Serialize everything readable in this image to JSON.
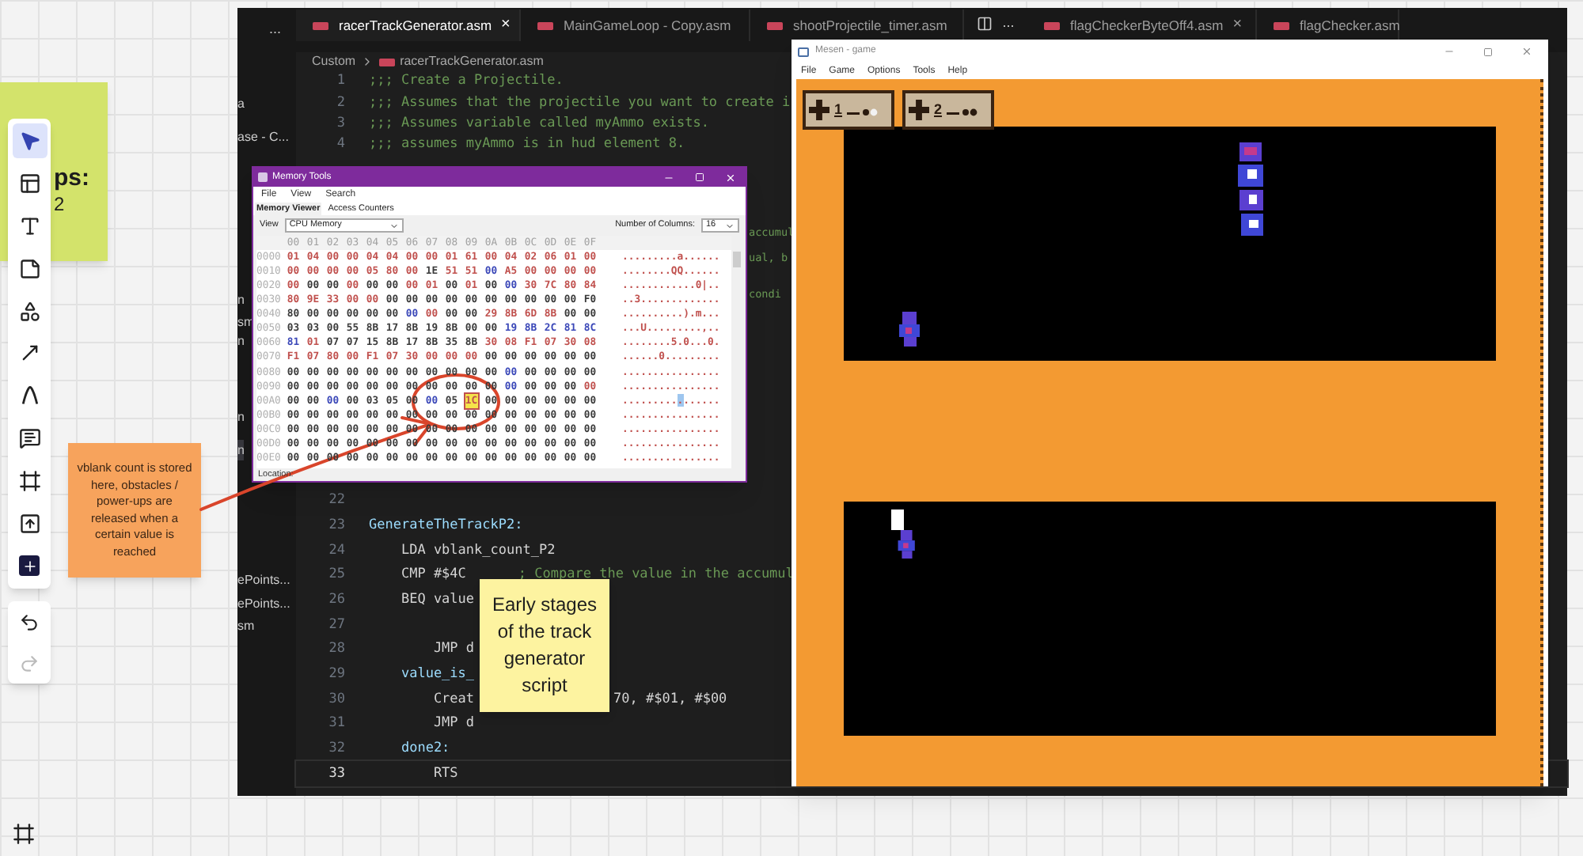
{
  "green_note": {
    "texts": [
      "ps:",
      "2"
    ]
  },
  "toolbar": {
    "tools": [
      {
        "kind": "select",
        "selected": true
      },
      {
        "kind": "templates",
        "selected": false
      },
      {
        "kind": "text",
        "selected": false
      },
      {
        "kind": "sticky",
        "selected": false
      },
      {
        "kind": "shapes",
        "selected": false
      },
      {
        "kind": "arrow",
        "selected": false
      },
      {
        "kind": "pen",
        "selected": false
      },
      {
        "kind": "comment",
        "selected": false
      },
      {
        "kind": "frame",
        "selected": false
      },
      {
        "kind": "upload",
        "selected": false
      },
      {
        "kind": "more",
        "selected": false
      }
    ]
  },
  "history": {
    "undo": {
      "disabled": false
    },
    "redo": {
      "disabled": true
    }
  },
  "orange_note": {
    "text": "vblank count is stored here, obstacles / power-ups are released when a certain value is reached"
  },
  "editor": {
    "sidebar_menu": "...",
    "sidebar_items": [
      {
        "label": "a",
        "selected": false
      },
      {
        "label": "ase - C...",
        "selected": false
      },
      {
        "label": "n",
        "selected": false
      },
      {
        "label": "sm",
        "selected": false
      },
      {
        "label": "n",
        "selected": false
      },
      {
        "label": "n",
        "selected": false
      },
      {
        "label": "n",
        "selected": true
      },
      {
        "label": "ePoints...",
        "selected": false
      },
      {
        "label": "ePoints...",
        "selected": false
      },
      {
        "label": "sm",
        "selected": false
      }
    ],
    "tabs": [
      {
        "label": "racerTrackGenerator.asm",
        "selected": true,
        "close": "×"
      },
      {
        "label": "MainGameLoop - Copy.asm",
        "selected": false
      },
      {
        "label": "shootProjectile_timer.asm",
        "selected": false
      },
      {
        "label": "flagCheckerByteOff4.asm",
        "selected": false,
        "close": "×"
      },
      {
        "label": "flagChecker.asm",
        "selected": false
      }
    ],
    "tab_actions_more": "...",
    "breadcrumb": [
      "Custom",
      "racerTrackGenerator.asm"
    ],
    "top_lines": [
      {
        "number": "1",
        "kind": "comment",
        "text": ";;; Create a Projectile."
      },
      {
        "number": "2",
        "kind": "comment",
        "text": ";;; Assumes that the projectile you want to create i"
      },
      {
        "number": "3",
        "kind": "comment",
        "text": ";;; Assumes variable called myAmmo exists."
      },
      {
        "number": "4",
        "kind": "comment",
        "text": ";;; assumes myAmmo is in hud element 8."
      }
    ],
    "fragments": [
      {
        "kind": "comment",
        "text": "accumul"
      },
      {
        "kind": "comment",
        "text": "ual, b"
      },
      {
        "kind": "comment",
        "text": "condi"
      }
    ],
    "bottom_lines": [
      {
        "number": "22",
        "current": false
      },
      {
        "number": "23",
        "kind": "label",
        "text": "GenerateTheTrackP2:",
        "current": false
      },
      {
        "number": "24",
        "kind": "code",
        "text": "    LDA vblank_count_P2",
        "current": false
      },
      {
        "number": "25",
        "kind": "code",
        "text": "    CMP #$4C",
        "comment": "; Compare the value in the accumul",
        "current": false
      },
      {
        "number": "26",
        "kind": "code",
        "text": "    BEQ value",
        "current": false
      },
      {
        "number": "27",
        "current": false
      },
      {
        "number": "28",
        "kind": "code",
        "text": "        JMP d",
        "current": false
      },
      {
        "number": "29",
        "kind": "label",
        "text": "    value_is_",
        "current": false
      },
      {
        "number": "30",
        "kind": "code",
        "text": "        Creat",
        "tail": "70, #$01, #$00",
        "current": false
      },
      {
        "number": "31",
        "kind": "code",
        "text": "        JMP d",
        "current": false
      },
      {
        "number": "32",
        "kind": "label",
        "text": "    done2:",
        "current": false
      },
      {
        "number": "33",
        "kind": "code",
        "text": "        RTS",
        "current": true
      }
    ]
  },
  "memory_tools": {
    "title": "Memory Tools",
    "menu": [
      "File",
      "View",
      "Search"
    ],
    "tabs": [
      {
        "label": "Memory Viewer",
        "selected": true
      },
      {
        "label": "Access Counters",
        "selected": false
      }
    ],
    "view_label": "View",
    "view_value": "CPU Memory",
    "columns_label": "Number of Columns:",
    "columns_value": "16",
    "header": [
      "00",
      "01",
      "02",
      "03",
      "04",
      "05",
      "06",
      "07",
      "08",
      "09",
      "0A",
      "0B",
      "0C",
      "0D",
      "0E",
      "0F"
    ],
    "rows": [
      {
        "address": "0000",
        "ascii": ".........a......",
        "cells": [
          {
            "value": "01",
            "color": "#c0504d",
            "selected": false
          },
          {
            "value": "04",
            "color": "#c0504d",
            "selected": false
          },
          {
            "value": "00",
            "color": "#c0504d",
            "selected": false
          },
          {
            "value": "00",
            "color": "#c0504d",
            "selected": false
          },
          {
            "value": "04",
            "color": "#c0504d",
            "selected": false
          },
          {
            "value": "04",
            "color": "#c0504d",
            "selected": false
          },
          {
            "value": "00",
            "color": "#c0504d",
            "selected": false
          },
          {
            "value": "00",
            "color": "#c0504d",
            "selected": false
          },
          {
            "value": "01",
            "color": "#c0504d",
            "selected": false
          },
          {
            "value": "61",
            "color": "#c0504d",
            "selected": false
          },
          {
            "value": "00",
            "color": "#c0504d",
            "selected": false
          },
          {
            "value": "04",
            "color": "#c0504d",
            "selected": false
          },
          {
            "value": "02",
            "color": "#c0504d",
            "selected": false
          },
          {
            "value": "06",
            "color": "#c0504d",
            "selected": false
          },
          {
            "value": "01",
            "color": "#c0504d",
            "selected": false
          },
          {
            "value": "00",
            "color": "#c0504d",
            "selected": false
          }
        ]
      },
      {
        "address": "0010",
        "ascii": "........QQ......",
        "cells": [
          {
            "value": "00",
            "color": "#c0504d",
            "selected": false
          },
          {
            "value": "00",
            "color": "#c0504d",
            "selected": false
          },
          {
            "value": "00",
            "color": "#c0504d",
            "selected": false
          },
          {
            "value": "00",
            "color": "#c0504d",
            "selected": false
          },
          {
            "value": "05",
            "color": "#c0504d",
            "selected": false
          },
          {
            "value": "80",
            "color": "#c0504d",
            "selected": false
          },
          {
            "value": "00",
            "color": "#c0504d",
            "selected": false
          },
          {
            "value": "1E",
            "color": "#3a3a3a",
            "selected": false
          },
          {
            "value": "51",
            "color": "#c0504d",
            "selected": false
          },
          {
            "value": "51",
            "color": "#c0504d",
            "selected": false
          },
          {
            "value": "00",
            "color": "#3a47b8",
            "selected": false
          },
          {
            "value": "A5",
            "color": "#c0504d",
            "selected": false
          },
          {
            "value": "00",
            "color": "#c0504d",
            "selected": false
          },
          {
            "value": "00",
            "color": "#c0504d",
            "selected": false
          },
          {
            "value": "00",
            "color": "#c0504d",
            "selected": false
          },
          {
            "value": "00",
            "color": "#c0504d",
            "selected": false
          }
        ]
      },
      {
        "address": "0020",
        "ascii": "............0|..",
        "cells": [
          {
            "value": "00",
            "color": "#c0504d",
            "selected": false
          },
          {
            "value": "00",
            "color": "#3a3a3a",
            "selected": false
          },
          {
            "value": "00",
            "color": "#3a3a3a",
            "selected": false
          },
          {
            "value": "00",
            "color": "#c0504d",
            "selected": false
          },
          {
            "value": "00",
            "color": "#3a3a3a",
            "selected": false
          },
          {
            "value": "00",
            "color": "#3a3a3a",
            "selected": false
          },
          {
            "value": "00",
            "color": "#c0504d",
            "selected": false
          },
          {
            "value": "01",
            "color": "#c0504d",
            "selected": false
          },
          {
            "value": "00",
            "color": "#3a3a3a",
            "selected": false
          },
          {
            "value": "01",
            "color": "#c0504d",
            "selected": false
          },
          {
            "value": "00",
            "color": "#3a3a3a",
            "selected": false
          },
          {
            "value": "00",
            "color": "#3a47b8",
            "selected": false
          },
          {
            "value": "30",
            "color": "#c0504d",
            "selected": false
          },
          {
            "value": "7C",
            "color": "#c0504d",
            "selected": false
          },
          {
            "value": "80",
            "color": "#c0504d",
            "selected": false
          },
          {
            "value": "84",
            "color": "#c0504d",
            "selected": false
          }
        ]
      },
      {
        "address": "0030",
        "ascii": "..3.............",
        "cells": [
          {
            "value": "80",
            "color": "#c0504d",
            "selected": false
          },
          {
            "value": "9E",
            "color": "#c0504d",
            "selected": false
          },
          {
            "value": "33",
            "color": "#c0504d",
            "selected": false
          },
          {
            "value": "00",
            "color": "#c0504d",
            "selected": false
          },
          {
            "value": "00",
            "color": "#c0504d",
            "selected": false
          },
          {
            "value": "00",
            "color": "#3a3a3a",
            "selected": false
          },
          {
            "value": "00",
            "color": "#3a3a3a",
            "selected": false
          },
          {
            "value": "00",
            "color": "#3a3a3a",
            "selected": false
          },
          {
            "value": "00",
            "color": "#3a3a3a",
            "selected": false
          },
          {
            "value": "00",
            "color": "#3a3a3a",
            "selected": false
          },
          {
            "value": "00",
            "color": "#3a3a3a",
            "selected": false
          },
          {
            "value": "00",
            "color": "#3a3a3a",
            "selected": false
          },
          {
            "value": "00",
            "color": "#3a3a3a",
            "selected": false
          },
          {
            "value": "00",
            "color": "#3a3a3a",
            "selected": false
          },
          {
            "value": "00",
            "color": "#3a3a3a",
            "selected": false
          },
          {
            "value": "F0",
            "color": "#3a3a3a",
            "selected": false
          }
        ]
      },
      {
        "address": "0040",
        "ascii": "..........).m...",
        "cells": [
          {
            "value": "80",
            "color": "#3a3a3a",
            "selected": false
          },
          {
            "value": "00",
            "color": "#3a3a3a",
            "selected": false
          },
          {
            "value": "00",
            "color": "#3a3a3a",
            "selected": false
          },
          {
            "value": "00",
            "color": "#3a3a3a",
            "selected": false
          },
          {
            "value": "00",
            "color": "#3a3a3a",
            "selected": false
          },
          {
            "value": "00",
            "color": "#3a3a3a",
            "selected": false
          },
          {
            "value": "00",
            "color": "#3a47b8",
            "selected": false
          },
          {
            "value": "00",
            "color": "#c0504d",
            "selected": false
          },
          {
            "value": "00",
            "color": "#3a3a3a",
            "selected": false
          },
          {
            "value": "00",
            "color": "#3a3a3a",
            "selected": false
          },
          {
            "value": "29",
            "color": "#c0504d",
            "selected": false
          },
          {
            "value": "8B",
            "color": "#c0504d",
            "selected": false
          },
          {
            "value": "6D",
            "color": "#c0504d",
            "selected": false
          },
          {
            "value": "8B",
            "color": "#c0504d",
            "selected": false
          },
          {
            "value": "00",
            "color": "#3a3a3a",
            "selected": false
          },
          {
            "value": "00",
            "color": "#3a3a3a",
            "selected": false
          }
        ]
      },
      {
        "address": "0050",
        "ascii": "...U.........,..",
        "cells": [
          {
            "value": "03",
            "color": "#3a3a3a",
            "selected": false
          },
          {
            "value": "03",
            "color": "#3a3a3a",
            "selected": false
          },
          {
            "value": "00",
            "color": "#3a3a3a",
            "selected": false
          },
          {
            "value": "55",
            "color": "#3a3a3a",
            "selected": false
          },
          {
            "value": "8B",
            "color": "#3a3a3a",
            "selected": false
          },
          {
            "value": "17",
            "color": "#3a3a3a",
            "selected": false
          },
          {
            "value": "8B",
            "color": "#3a3a3a",
            "selected": false
          },
          {
            "value": "19",
            "color": "#3a3a3a",
            "selected": false
          },
          {
            "value": "8B",
            "color": "#3a3a3a",
            "selected": false
          },
          {
            "value": "00",
            "color": "#3a3a3a",
            "selected": false
          },
          {
            "value": "00",
            "color": "#3a3a3a",
            "selected": false
          },
          {
            "value": "19",
            "color": "#3a47b8",
            "selected": false
          },
          {
            "value": "8B",
            "color": "#3a47b8",
            "selected": false
          },
          {
            "value": "2C",
            "color": "#3a47b8",
            "selected": false
          },
          {
            "value": "81",
            "color": "#3a47b8",
            "selected": false
          },
          {
            "value": "8C",
            "color": "#3a47b8",
            "selected": false
          }
        ]
      },
      {
        "address": "0060",
        "ascii": "........5.0...0.",
        "cells": [
          {
            "value": "81",
            "color": "#3a47b8",
            "selected": false
          },
          {
            "value": "01",
            "color": "#c0504d",
            "selected": false
          },
          {
            "value": "07",
            "color": "#3a3a3a",
            "selected": false
          },
          {
            "value": "07",
            "color": "#3a3a3a",
            "selected": false
          },
          {
            "value": "15",
            "color": "#3a3a3a",
            "selected": false
          },
          {
            "value": "8B",
            "color": "#3a3a3a",
            "selected": false
          },
          {
            "value": "17",
            "color": "#3a3a3a",
            "selected": false
          },
          {
            "value": "8B",
            "color": "#3a3a3a",
            "selected": false
          },
          {
            "value": "35",
            "color": "#3a3a3a",
            "selected": false
          },
          {
            "value": "8B",
            "color": "#3a3a3a",
            "selected": false
          },
          {
            "value": "30",
            "color": "#c0504d",
            "selected": false
          },
          {
            "value": "08",
            "color": "#c0504d",
            "selected": false
          },
          {
            "value": "F1",
            "color": "#c0504d",
            "selected": false
          },
          {
            "value": "07",
            "color": "#c0504d",
            "selected": false
          },
          {
            "value": "30",
            "color": "#c0504d",
            "selected": false
          },
          {
            "value": "08",
            "color": "#c0504d",
            "selected": false
          }
        ]
      },
      {
        "address": "0070",
        "ascii": "......0.........",
        "cells": [
          {
            "value": "F1",
            "color": "#c0504d",
            "selected": false
          },
          {
            "value": "07",
            "color": "#c0504d",
            "selected": false
          },
          {
            "value": "80",
            "color": "#c0504d",
            "selected": false
          },
          {
            "value": "00",
            "color": "#c0504d",
            "selected": false
          },
          {
            "value": "F1",
            "color": "#c0504d",
            "selected": false
          },
          {
            "value": "07",
            "color": "#c0504d",
            "selected": false
          },
          {
            "value": "30",
            "color": "#c0504d",
            "selected": false
          },
          {
            "value": "00",
            "color": "#c0504d",
            "selected": false
          },
          {
            "value": "00",
            "color": "#c0504d",
            "selected": false
          },
          {
            "value": "00",
            "color": "#c0504d",
            "selected": false
          },
          {
            "value": "00",
            "color": "#3a3a3a",
            "selected": false
          },
          {
            "value": "00",
            "color": "#3a3a3a",
            "selected": false
          },
          {
            "value": "00",
            "color": "#3a3a3a",
            "selected": false
          },
          {
            "value": "00",
            "color": "#3a3a3a",
            "selected": false
          },
          {
            "value": "00",
            "color": "#3a3a3a",
            "selected": false
          },
          {
            "value": "00",
            "color": "#3a3a3a",
            "selected": false
          }
        ]
      },
      {
        "address": "0080",
        "ascii": "................",
        "cells": [
          {
            "value": "00",
            "color": "#3a3a3a",
            "selected": false
          },
          {
            "value": "00",
            "color": "#3a3a3a",
            "selected": false
          },
          {
            "value": "00",
            "color": "#3a3a3a",
            "selected": false
          },
          {
            "value": "00",
            "color": "#3a3a3a",
            "selected": false
          },
          {
            "value": "00",
            "color": "#3a3a3a",
            "selected": false
          },
          {
            "value": "00",
            "color": "#3a3a3a",
            "selected": false
          },
          {
            "value": "00",
            "color": "#3a3a3a",
            "selected": false
          },
          {
            "value": "00",
            "color": "#3a3a3a",
            "selected": false
          },
          {
            "value": "00",
            "color": "#3a3a3a",
            "selected": false
          },
          {
            "value": "00",
            "color": "#3a3a3a",
            "selected": false
          },
          {
            "value": "00",
            "color": "#3a3a3a",
            "selected": false
          },
          {
            "value": "00",
            "color": "#3a47b8",
            "selected": false
          },
          {
            "value": "00",
            "color": "#3a3a3a",
            "selected": false
          },
          {
            "value": "00",
            "color": "#3a3a3a",
            "selected": false
          },
          {
            "value": "00",
            "color": "#3a3a3a",
            "selected": false
          },
          {
            "value": "00",
            "color": "#3a3a3a",
            "selected": false
          }
        ]
      },
      {
        "address": "0090",
        "ascii": "................",
        "cells": [
          {
            "value": "00",
            "color": "#3a3a3a",
            "selected": false
          },
          {
            "value": "00",
            "color": "#3a3a3a",
            "selected": false
          },
          {
            "value": "00",
            "color": "#3a3a3a",
            "selected": false
          },
          {
            "value": "00",
            "color": "#3a3a3a",
            "selected": false
          },
          {
            "value": "00",
            "color": "#3a3a3a",
            "selected": false
          },
          {
            "value": "00",
            "color": "#3a3a3a",
            "selected": false
          },
          {
            "value": "00",
            "color": "#3a3a3a",
            "selected": false
          },
          {
            "value": "00",
            "color": "#3a3a3a",
            "selected": false
          },
          {
            "value": "00",
            "color": "#3a3a3a",
            "selected": false
          },
          {
            "value": "00",
            "color": "#3a3a3a",
            "selected": false
          },
          {
            "value": "00",
            "color": "#3a3a3a",
            "selected": false
          },
          {
            "value": "00",
            "color": "#3a47b8",
            "selected": false
          },
          {
            "value": "00",
            "color": "#3a3a3a",
            "selected": false
          },
          {
            "value": "00",
            "color": "#3a3a3a",
            "selected": false
          },
          {
            "value": "00",
            "color": "#3a3a3a",
            "selected": false
          },
          {
            "value": "00",
            "color": "#c0504d",
            "selected": false
          }
        ]
      },
      {
        "address": "00A0",
        "ascii": "................",
        "cells": [
          {
            "value": "00",
            "color": "#3a3a3a",
            "selected": false
          },
          {
            "value": "00",
            "color": "#3a3a3a",
            "selected": false
          },
          {
            "value": "00",
            "color": "#3a47b8",
            "selected": false
          },
          {
            "value": "00",
            "color": "#3a3a3a",
            "selected": false
          },
          {
            "value": "03",
            "color": "#3a3a3a",
            "selected": false
          },
          {
            "value": "05",
            "color": "#3a3a3a",
            "selected": false
          },
          {
            "value": "00",
            "color": "#3a3a3a",
            "selected": false
          },
          {
            "value": "00",
            "color": "#3a47b8",
            "selected": false
          },
          {
            "value": "05",
            "color": "#3a3a3a",
            "selected": false
          },
          {
            "value": "1C",
            "color": "#c0504d",
            "selected": true
          },
          {
            "value": "00",
            "color": "#3a3a3a",
            "selected": false
          },
          {
            "value": "00",
            "color": "#3a3a3a",
            "selected": false
          },
          {
            "value": "00",
            "color": "#3a3a3a",
            "selected": false
          },
          {
            "value": "00",
            "color": "#3a3a3a",
            "selected": false
          },
          {
            "value": "00",
            "color": "#3a3a3a",
            "selected": false
          },
          {
            "value": "00",
            "color": "#3a3a3a",
            "selected": false
          }
        ]
      },
      {
        "address": "00B0",
        "ascii": "................",
        "cells": [
          {
            "value": "00",
            "color": "#3a3a3a",
            "selected": false
          },
          {
            "value": "00",
            "color": "#3a3a3a",
            "selected": false
          },
          {
            "value": "00",
            "color": "#3a3a3a",
            "selected": false
          },
          {
            "value": "00",
            "color": "#3a3a3a",
            "selected": false
          },
          {
            "value": "00",
            "color": "#3a3a3a",
            "selected": false
          },
          {
            "value": "00",
            "color": "#3a3a3a",
            "selected": false
          },
          {
            "value": "00",
            "color": "#3a3a3a",
            "selected": false
          },
          {
            "value": "00",
            "color": "#3a3a3a",
            "selected": false
          },
          {
            "value": "00",
            "color": "#3a3a3a",
            "selected": false
          },
          {
            "value": "00",
            "color": "#3a3a3a",
            "selected": false
          },
          {
            "value": "00",
            "color": "#3a3a3a",
            "selected": false
          },
          {
            "value": "00",
            "color": "#3a3a3a",
            "selected": false
          },
          {
            "value": "00",
            "color": "#3a3a3a",
            "selected": false
          },
          {
            "value": "00",
            "color": "#3a3a3a",
            "selected": false
          },
          {
            "value": "00",
            "color": "#3a3a3a",
            "selected": false
          },
          {
            "value": "00",
            "color": "#3a3a3a",
            "selected": false
          }
        ]
      },
      {
        "address": "00C0",
        "ascii": "................",
        "cells": [
          {
            "value": "00",
            "color": "#3a3a3a",
            "selected": false
          },
          {
            "value": "00",
            "color": "#3a3a3a",
            "selected": false
          },
          {
            "value": "00",
            "color": "#3a3a3a",
            "selected": false
          },
          {
            "value": "00",
            "color": "#3a3a3a",
            "selected": false
          },
          {
            "value": "00",
            "color": "#3a3a3a",
            "selected": false
          },
          {
            "value": "00",
            "color": "#3a3a3a",
            "selected": false
          },
          {
            "value": "00",
            "color": "#3a3a3a",
            "selected": false
          },
          {
            "value": "00",
            "color": "#3a3a3a",
            "selected": false
          },
          {
            "value": "00",
            "color": "#3a3a3a",
            "selected": false
          },
          {
            "value": "00",
            "color": "#3a3a3a",
            "selected": false
          },
          {
            "value": "00",
            "color": "#3a3a3a",
            "selected": false
          },
          {
            "value": "00",
            "color": "#3a3a3a",
            "selected": false
          },
          {
            "value": "00",
            "color": "#3a3a3a",
            "selected": false
          },
          {
            "value": "00",
            "color": "#3a3a3a",
            "selected": false
          },
          {
            "value": "00",
            "color": "#3a3a3a",
            "selected": false
          },
          {
            "value": "00",
            "color": "#3a3a3a",
            "selected": false
          }
        ]
      },
      {
        "address": "00D0",
        "ascii": "................",
        "cells": [
          {
            "value": "00",
            "color": "#3a3a3a",
            "selected": false
          },
          {
            "value": "00",
            "color": "#3a3a3a",
            "selected": false
          },
          {
            "value": "00",
            "color": "#3a3a3a",
            "selected": false
          },
          {
            "value": "00",
            "color": "#3a3a3a",
            "selected": false
          },
          {
            "value": "00",
            "color": "#3a3a3a",
            "selected": false
          },
          {
            "value": "00",
            "color": "#3a3a3a",
            "selected": false
          },
          {
            "value": "00",
            "color": "#3a3a3a",
            "selected": false
          },
          {
            "value": "00",
            "color": "#3a3a3a",
            "selected": false
          },
          {
            "value": "00",
            "color": "#3a3a3a",
            "selected": false
          },
          {
            "value": "00",
            "color": "#3a3a3a",
            "selected": false
          },
          {
            "value": "00",
            "color": "#3a3a3a",
            "selected": false
          },
          {
            "value": "00",
            "color": "#3a3a3a",
            "selected": false
          },
          {
            "value": "00",
            "color": "#3a3a3a",
            "selected": false
          },
          {
            "value": "00",
            "color": "#3a3a3a",
            "selected": false
          },
          {
            "value": "00",
            "color": "#3a3a3a",
            "selected": false
          },
          {
            "value": "00",
            "color": "#3a3a3a",
            "selected": false
          }
        ]
      },
      {
        "address": "00E0",
        "ascii": "................",
        "cells": [
          {
            "value": "00",
            "color": "#3a3a3a",
            "selected": false
          },
          {
            "value": "00",
            "color": "#3a3a3a",
            "selected": false
          },
          {
            "value": "00",
            "color": "#3a3a3a",
            "selected": false
          },
          {
            "value": "00",
            "color": "#3a3a3a",
            "selected": false
          },
          {
            "value": "00",
            "color": "#3a3a3a",
            "selected": false
          },
          {
            "value": "00",
            "color": "#3a3a3a",
            "selected": false
          },
          {
            "value": "00",
            "color": "#3a3a3a",
            "selected": false
          },
          {
            "value": "00",
            "color": "#3a3a3a",
            "selected": false
          },
          {
            "value": "00",
            "color": "#3a3a3a",
            "selected": false
          },
          {
            "value": "00",
            "color": "#3a3a3a",
            "selected": false
          },
          {
            "value": "00",
            "color": "#3a3a3a",
            "selected": false
          },
          {
            "value": "00",
            "color": "#3a3a3a",
            "selected": false
          },
          {
            "value": "00",
            "color": "#3a3a3a",
            "selected": false
          },
          {
            "value": "00",
            "color": "#3a3a3a",
            "selected": false
          },
          {
            "value": "00",
            "color": "#3a3a3a",
            "selected": false
          },
          {
            "value": "00",
            "color": "#3a3a3a",
            "selected": false
          }
        ]
      }
    ],
    "location_label": "Location:"
  },
  "game_window": {
    "title": "Mesen - game",
    "menu": [
      "File",
      "Game",
      "Options",
      "Tools",
      "Help"
    ],
    "players": [
      {
        "number": "1"
      },
      {
        "number": "2"
      }
    ]
  },
  "yellow_note": {
    "text": "Early stages of the track generator script"
  }
}
